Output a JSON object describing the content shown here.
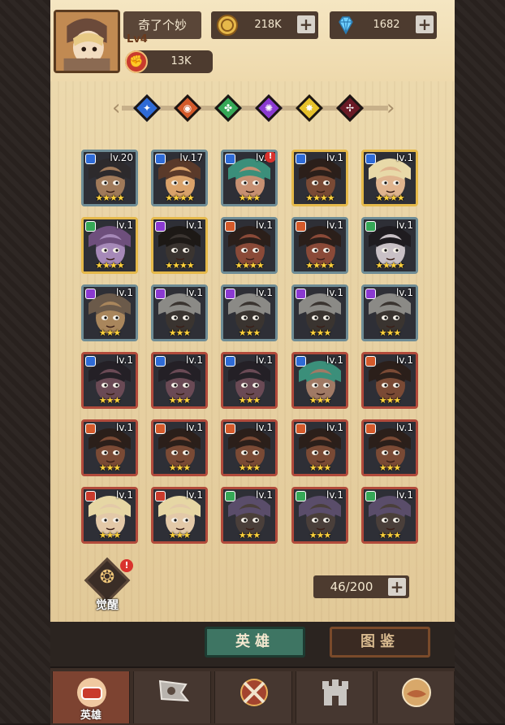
{
  "player": {
    "name": "奇了个妙",
    "level": "Lv4",
    "power": "13K"
  },
  "resources": {
    "gold": {
      "value": "218K",
      "icon": "coin-icon"
    },
    "diamond": {
      "value": "1682",
      "icon": "diamond-icon"
    }
  },
  "filters": [
    {
      "name": "filter-blue",
      "color": "#2f6bd6",
      "symbol": "✦"
    },
    {
      "name": "filter-orange",
      "color": "#d45a2b",
      "symbol": "◉"
    },
    {
      "name": "filter-green",
      "color": "#36a857",
      "symbol": "✤"
    },
    {
      "name": "filter-purple",
      "color": "#8b3ad1",
      "symbol": "✺"
    },
    {
      "name": "filter-yellow",
      "color": "#e7c22b",
      "symbol": "✸"
    },
    {
      "name": "filter-crimson",
      "color": "#6a1a26",
      "symbol": "✢"
    }
  ],
  "heroes": [
    {
      "level": "lv.20",
      "stars": 4,
      "frame": "blue",
      "cls": "#2f6bd6",
      "skin": "#a07a5a",
      "hair": "#2d2a2c"
    },
    {
      "level": "lv.17",
      "stars": 4,
      "frame": "blue",
      "cls": "#2f6bd6",
      "skin": "#d9a26a",
      "hair": "#5a3a2a"
    },
    {
      "level": "lv.2",
      "stars": 3,
      "frame": "blue",
      "cls": "#2f6bd6",
      "skin": "#c79072",
      "hair": "#3b8f7a",
      "alert": true
    },
    {
      "level": "lv.1",
      "stars": 4,
      "frame": "gold",
      "cls": "#2f6bd6",
      "skin": "#7a4a35",
      "hair": "#2b1f1a"
    },
    {
      "level": "lv.1",
      "stars": 4,
      "frame": "gold",
      "cls": "#2f6bd6",
      "skin": "#e0b48e",
      "hair": "#e8d9a8"
    },
    {
      "level": "lv.1",
      "stars": 4,
      "frame": "gold",
      "cls": "#36a857",
      "skin": "#a689b8",
      "hair": "#6e4f7c"
    },
    {
      "level": "lv.1",
      "stars": 4,
      "frame": "gold",
      "cls": "#8b3ad1",
      "skin": "#3a3430",
      "hair": "#1d1916"
    },
    {
      "level": "lv.1",
      "stars": 4,
      "frame": "blue",
      "cls": "#d45a2b",
      "skin": "#8a4a38",
      "hair": "#2b1f1a"
    },
    {
      "level": "lv.1",
      "stars": 4,
      "frame": "blue",
      "cls": "#d45a2b",
      "skin": "#8a4a38",
      "hair": "#2b1f1a"
    },
    {
      "level": "lv.1",
      "stars": 4,
      "frame": "blue",
      "cls": "#36a857",
      "skin": "#c9c1c6",
      "hair": "#1f1c20"
    },
    {
      "level": "lv.1",
      "stars": 3,
      "frame": "blue",
      "cls": "#8b3ad1",
      "skin": "#a9865c",
      "hair": "#6b5a4a"
    },
    {
      "level": "lv.1",
      "stars": 3,
      "frame": "blue",
      "cls": "#8b3ad1",
      "skin": "#3a3430",
      "hair": "#8b8a86"
    },
    {
      "level": "lv.1",
      "stars": 3,
      "frame": "blue",
      "cls": "#8b3ad1",
      "skin": "#3a3430",
      "hair": "#8b8a86"
    },
    {
      "level": "lv.1",
      "stars": 3,
      "frame": "blue",
      "cls": "#8b3ad1",
      "skin": "#3a3430",
      "hair": "#8b8a86"
    },
    {
      "level": "lv.1",
      "stars": 3,
      "frame": "blue",
      "cls": "#8b3ad1",
      "skin": "#3a3430",
      "hair": "#8b8a86"
    },
    {
      "level": "lv.1",
      "stars": 3,
      "frame": "red",
      "cls": "#2f6bd6",
      "skin": "#6a4a55",
      "hair": "#242026"
    },
    {
      "level": "lv.1",
      "stars": 3,
      "frame": "red",
      "cls": "#2f6bd6",
      "skin": "#6a4a55",
      "hair": "#242026"
    },
    {
      "level": "lv.1",
      "stars": 3,
      "frame": "red",
      "cls": "#2f6bd6",
      "skin": "#6a4a55",
      "hair": "#242026"
    },
    {
      "level": "lv.1",
      "stars": 3,
      "frame": "red",
      "cls": "#2f6bd6",
      "skin": "#a07a65",
      "hair": "#3b8f7a"
    },
    {
      "level": "lv.1",
      "stars": 3,
      "frame": "red",
      "cls": "#d45a2b",
      "skin": "#7a4a35",
      "hair": "#2b1f1a"
    },
    {
      "level": "lv.1",
      "stars": 3,
      "frame": "red",
      "cls": "#d45a2b",
      "skin": "#7a4a35",
      "hair": "#2b1f1a"
    },
    {
      "level": "lv.1",
      "stars": 3,
      "frame": "red",
      "cls": "#d45a2b",
      "skin": "#7a4a35",
      "hair": "#2b1f1a"
    },
    {
      "level": "lv.1",
      "stars": 3,
      "frame": "red",
      "cls": "#d45a2b",
      "skin": "#7a4a35",
      "hair": "#2b1f1a"
    },
    {
      "level": "lv.1",
      "stars": 3,
      "frame": "red",
      "cls": "#d45a2b",
      "skin": "#7a4a35",
      "hair": "#2b1f1a"
    },
    {
      "level": "lv.1",
      "stars": 3,
      "frame": "red",
      "cls": "#d45a2b",
      "skin": "#7a4a35",
      "hair": "#2b1f1a"
    },
    {
      "level": "lv.1",
      "stars": 3,
      "frame": "red",
      "cls": "#c93b2d",
      "skin": "#e3c9a8",
      "hair": "#e6d6a4"
    },
    {
      "level": "lv.1",
      "stars": 3,
      "frame": "red",
      "cls": "#c93b2d",
      "skin": "#e3c9a8",
      "hair": "#e6d6a4"
    },
    {
      "level": "lv.1",
      "stars": 3,
      "frame": "red",
      "cls": "#36a857",
      "skin": "#4a3f3a",
      "hair": "#5a4d6a"
    },
    {
      "level": "lv.1",
      "stars": 3,
      "frame": "red",
      "cls": "#36a857",
      "skin": "#4a3f3a",
      "hair": "#5a4d6a"
    },
    {
      "level": "lv.1",
      "stars": 3,
      "frame": "red",
      "cls": "#36a857",
      "skin": "#4a3f3a",
      "hair": "#5a4d6a"
    }
  ],
  "awaken": {
    "label": "觉醒"
  },
  "capacity": {
    "value": "46/200"
  },
  "tabs": {
    "heroes": "英雄",
    "codex": "图鉴"
  },
  "nav": [
    {
      "name": "nav-heroes",
      "label": "英雄",
      "active": true,
      "icon": "fist-icon"
    },
    {
      "name": "nav-adventure",
      "label": "",
      "active": false,
      "icon": "banner-icon"
    },
    {
      "name": "nav-battle",
      "label": "",
      "active": false,
      "icon": "crossed-swords-icon"
    },
    {
      "name": "nav-castle",
      "label": "",
      "active": false,
      "icon": "castle-icon"
    },
    {
      "name": "nav-guild",
      "label": "",
      "active": false,
      "icon": "handshake-icon"
    }
  ]
}
